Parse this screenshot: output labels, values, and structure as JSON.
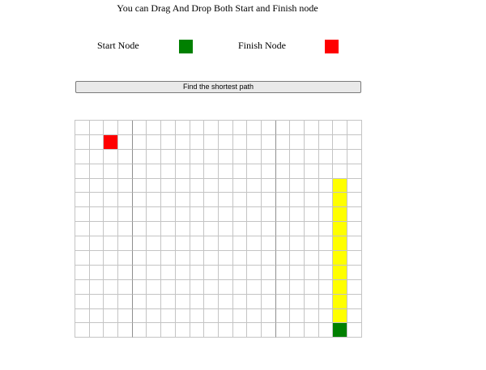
{
  "instruction": "You can Drag And Drop Both Start and Finish node",
  "legend": {
    "start_label": "Start Node",
    "finish_label": "Finish Node",
    "start_color": "#008000",
    "finish_color": "#ff0000",
    "path_color": "#ffff00"
  },
  "find_button_label": "Find the shortest path",
  "grid": {
    "rows": 15,
    "cols": 20,
    "start": {
      "row": 14,
      "col": 18
    },
    "finish": {
      "row": 1,
      "col": 2
    },
    "path": [
      {
        "row": 4,
        "col": 18
      },
      {
        "row": 5,
        "col": 18
      },
      {
        "row": 6,
        "col": 18
      },
      {
        "row": 7,
        "col": 18
      },
      {
        "row": 8,
        "col": 18
      },
      {
        "row": 9,
        "col": 18
      },
      {
        "row": 10,
        "col": 18
      },
      {
        "row": 11,
        "col": 18
      },
      {
        "row": 12,
        "col": 18
      },
      {
        "row": 13,
        "col": 18
      }
    ]
  }
}
